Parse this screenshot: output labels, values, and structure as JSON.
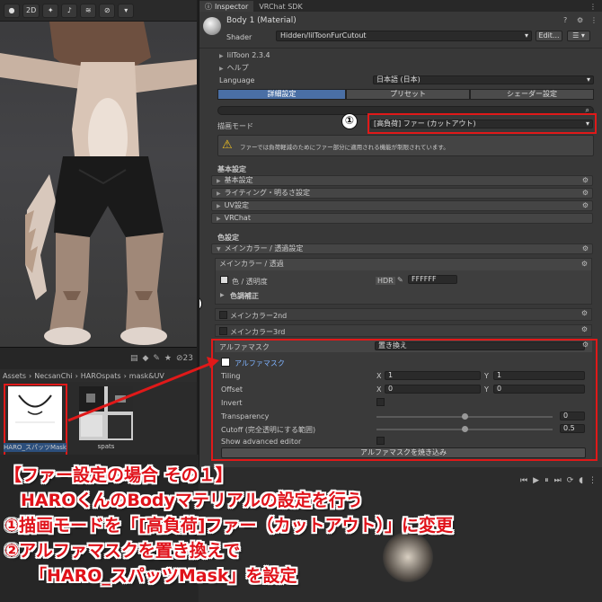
{
  "scene": {
    "toolbar": {
      "mode_2d": "2D",
      "items": [
        "lighting-icon",
        "audio-icon",
        "effects-icon",
        "hidden-icon",
        "gizmos-icon"
      ]
    }
  },
  "project": {
    "breadcrumb": [
      "Assets",
      "NecsanChi",
      "HAROspats",
      "mask&UV"
    ],
    "toolbar_count": "23",
    "assets": [
      {
        "name": "HARO_スパッツMask",
        "selected": true
      },
      {
        "name": "spats",
        "selected": false
      }
    ]
  },
  "inspector": {
    "tabs": [
      "Inspector",
      "VRChat SDK"
    ],
    "material_title": "Body 1 (Material)",
    "shader_label": "Shader",
    "shader_value": "Hidden/lilToonFurCutout",
    "edit_label": "Edit...",
    "version": "lilToon 2.3.4",
    "help": "ヘルプ",
    "language_label": "Language",
    "language_value": "日本語 (日本)",
    "mode_tabs": [
      "詳細設定",
      "プリセット",
      "シェーダー設定"
    ],
    "render_mode_label": "描画モード",
    "render_mode_value": "[高負荷] ファー (カットアウト)",
    "warning_text": "ファーでは負荷軽減のためにファー部分に適用される機能が制限されています。",
    "basic_settings_header": "基本設定",
    "basic_sections": [
      "基本設定",
      "ライティング・明るさ設定",
      "UV設定",
      "VRChat"
    ],
    "color_settings_header": "色設定",
    "main_color_section": "メインカラー / 透過設定",
    "main_color_sub": "メインカラー / 透過",
    "color_alpha_label": "色 / 透明度",
    "hdr_label": "HDR",
    "color_hex": "FFFFFF",
    "color_correction": "色調補正",
    "main2_label": "メインカラー2nd",
    "main3_label": "メインカラー3rd",
    "alpha_mask": {
      "label": "アルファマスク",
      "mode": "置き換え",
      "texture_label": "アルファマスク",
      "tiling_label": "Tiling",
      "tiling_x": "1",
      "tiling_y": "1",
      "offset_label": "Offset",
      "offset_x": "0",
      "offset_y": "0",
      "invert_label": "Invert",
      "transparency_label": "Transparency",
      "transparency_value": "0",
      "transparency_fraction": 0.5,
      "cutoff_label": "Cutoff (完全透明にする範囲)",
      "cutoff_value": "0.5",
      "cutoff_fraction": 0.5,
      "advanced_label": "Show advanced editor",
      "bake_button": "アルファマスクを焼き込み",
      "x_label": "X",
      "y_label": "Y"
    }
  },
  "annotations": {
    "marker_1": "①",
    "marker_2": "②"
  },
  "caption": {
    "line1": "【ファー設定の場合 その１】",
    "line2": "HAROくんのBodyマテリアルの設定を行う",
    "line3": "①描画モードを「[高負荷]ファー（カットアウト）」に変更",
    "line4": "②アルファマスクを置き換えで",
    "line5": "「HARO_スパッツMask」を設定"
  },
  "colors": {
    "annotation_red": "#e01919",
    "caption_red": "#e0121a",
    "tab_active_blue": "#4a6fa5"
  }
}
